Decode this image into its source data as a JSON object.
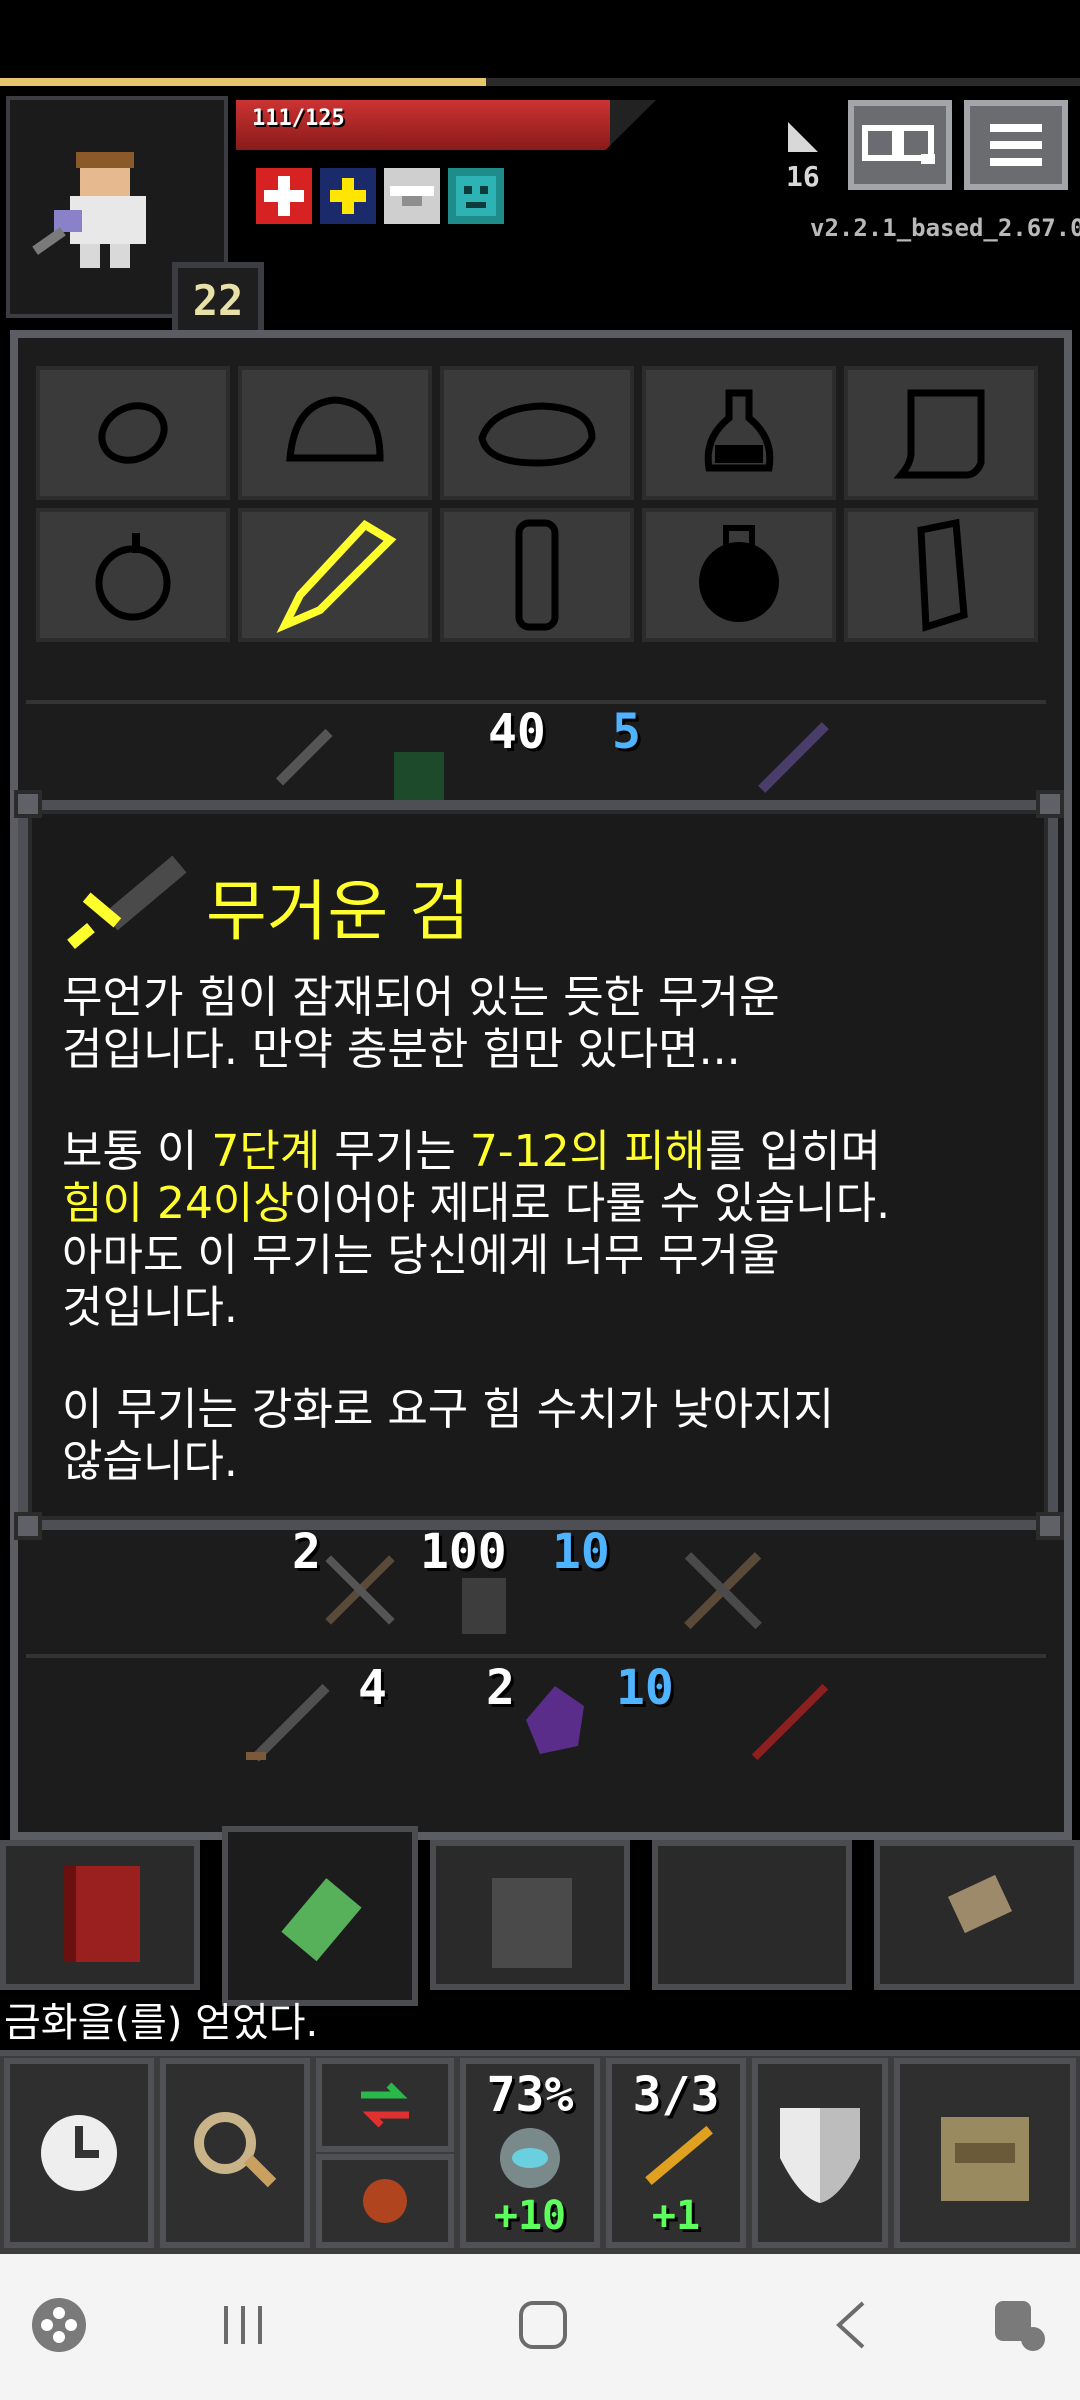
{
  "hero": {
    "hp_text": "111/125",
    "hp_fraction": 0.89,
    "level": "22",
    "xp_fraction": 0.45
  },
  "hud": {
    "depth": "16",
    "version": "v2.2.1_based_2.67.0"
  },
  "buffs": [
    {
      "icon": "red-cross-buff-icon",
      "color": "#d62222"
    },
    {
      "icon": "yellow-cross-buff-icon",
      "color": "#1a2a6a"
    },
    {
      "icon": "white-bar-buff-icon",
      "color": "#cfcfcf"
    },
    {
      "icon": "teal-face-buff-icon",
      "color": "#1f8c8c"
    }
  ],
  "inventory": {
    "slot_icons": [
      "ring-slot-icon",
      "cap-slot-icon",
      "armor-slot-icon",
      "potion-slot-icon",
      "scroll-slot-icon",
      "seed-slot-icon",
      "wand-slot-icon",
      "stone-slot-icon",
      "bomb-slot-icon",
      "food-slot-icon"
    ],
    "row_counts_1": [
      "40",
      "5"
    ],
    "row_counts_2": [
      "2",
      "100",
      "10"
    ],
    "row_counts_3": [
      "4",
      "2",
      "10"
    ]
  },
  "item_info": {
    "title": "무거운 검",
    "desc1_line1": "무언가 힘이 잠재되어 있는 듯한 무거운",
    "desc1_line2": "검입니다. 만약 충분한 힘만 있다면...",
    "desc2_a": "보통 이 ",
    "desc2_tier": "7단계",
    "desc2_b": " 무기는 ",
    "desc2_dmg": "7-12의 피해",
    "desc2_c": "를 입히며",
    "desc2_str": "힘이 24이상",
    "desc2_d": "이어야 제대로 다룰 수 있습니다.",
    "desc2_line3": "아마도 이 무기는 당신에게 너무 무거울",
    "desc2_line4": "것입니다.",
    "desc3_line1": "이 무기는 강화로 요구 힘 수치가 낮아지지",
    "desc3_line2": "않습니다."
  },
  "log": {
    "text": "금화을(를) 얻었다."
  },
  "quickslots": [
    {
      "count": "73%",
      "bonus": "+10"
    },
    {
      "count": "3/3",
      "bonus": "+1"
    }
  ],
  "colors": {
    "highlight": "#ffff2e",
    "hp": "#c33",
    "frame": "#5b5d62"
  }
}
